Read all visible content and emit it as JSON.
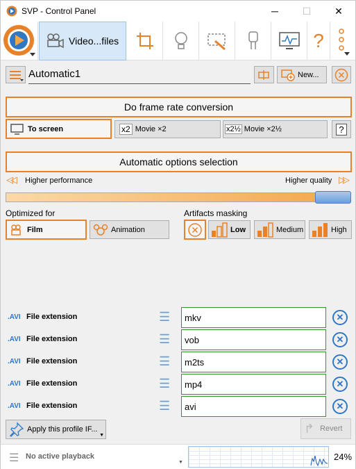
{
  "title": "SVP - Control Panel",
  "window": {
    "minimize": "─",
    "maximize": "☐",
    "close": "✕"
  },
  "toolbar": {
    "video_profiles": "Video...files"
  },
  "profile": {
    "name": "Automatic1",
    "new_label": "New..."
  },
  "frame_rate": {
    "heading": "Do frame rate conversion",
    "to_screen": "To screen",
    "movie_x2_icon": "x2",
    "movie_x2": "Movie ×2",
    "movie_x25_icon": "x2½",
    "movie_x25": "Movie ×2½",
    "help": "?"
  },
  "options": {
    "heading": "Automatic options selection",
    "higher_performance": "Higher performance",
    "higher_quality": "Higher quality",
    "slider_value": 0.9
  },
  "optimized": {
    "label": "Optimized for",
    "film": "Film",
    "animation": "Animation"
  },
  "artifacts": {
    "label": "Artifacts masking",
    "low": "Low",
    "medium": "Medium",
    "high": "High"
  },
  "conditions": [
    {
      "badge": ".AVI",
      "label": "File extension",
      "value": "mkv"
    },
    {
      "badge": ".AVI",
      "label": "File extension",
      "value": "vob"
    },
    {
      "badge": ".AVI",
      "label": "File extension",
      "value": "m2ts"
    },
    {
      "badge": ".AVI",
      "label": "File extension",
      "value": "mp4"
    },
    {
      "badge": ".AVI",
      "label": "File extension",
      "value": "avi"
    }
  ],
  "footer": {
    "apply": "Apply this profile IF...",
    "revert": "Revert"
  },
  "status": {
    "playback": "No active playback",
    "cpu": "24%"
  },
  "colors": {
    "accent": "#e8822a",
    "blue": "#2f78c4",
    "green": "#2a9a2a"
  }
}
